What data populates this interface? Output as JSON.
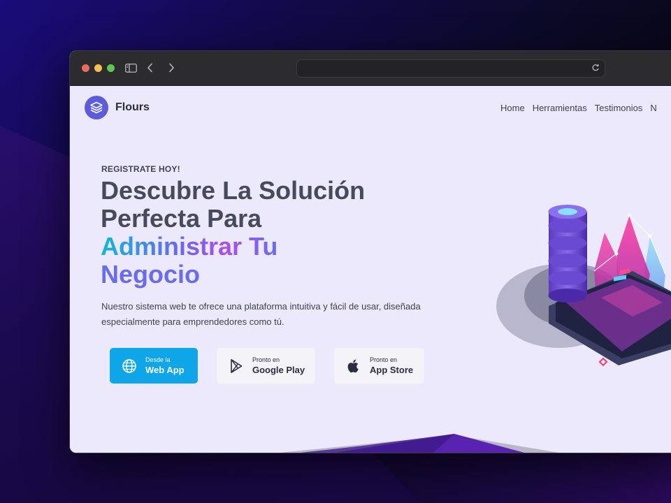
{
  "browser": {
    "url": ""
  },
  "brand": {
    "name": "Flours"
  },
  "nav": {
    "items": [
      "Home",
      "Herramientas",
      "Testimonios",
      "N"
    ]
  },
  "hero": {
    "eyebrow": "REGISTRATE HOY!",
    "headline_line1": "Descubre La Solución",
    "headline_line2": "Perfecta Para",
    "headline_highlight": "Administrar Tu",
    "headline_line4": "Negocio",
    "description": "Nuestro sistema web te ofrece una plataforma intuitiva y fácil de usar, diseñada especialmente para emprendedores como tú."
  },
  "buttons": {
    "web": {
      "small": "Desde la",
      "big": "Web App"
    },
    "google": {
      "small": "Pronto en",
      "big": "Google Play"
    },
    "apple": {
      "small": "Pronto en",
      "big": "App Store"
    }
  },
  "colors": {
    "accent": "#0ea5e9",
    "brand": "#5b5bdc",
    "page_bg": "#ede9fd"
  },
  "icons": [
    "layers-icon",
    "sidebar-icon",
    "chevron-left-icon",
    "chevron-right-icon",
    "reload-icon",
    "globe-icon",
    "play-store-icon",
    "apple-icon"
  ]
}
